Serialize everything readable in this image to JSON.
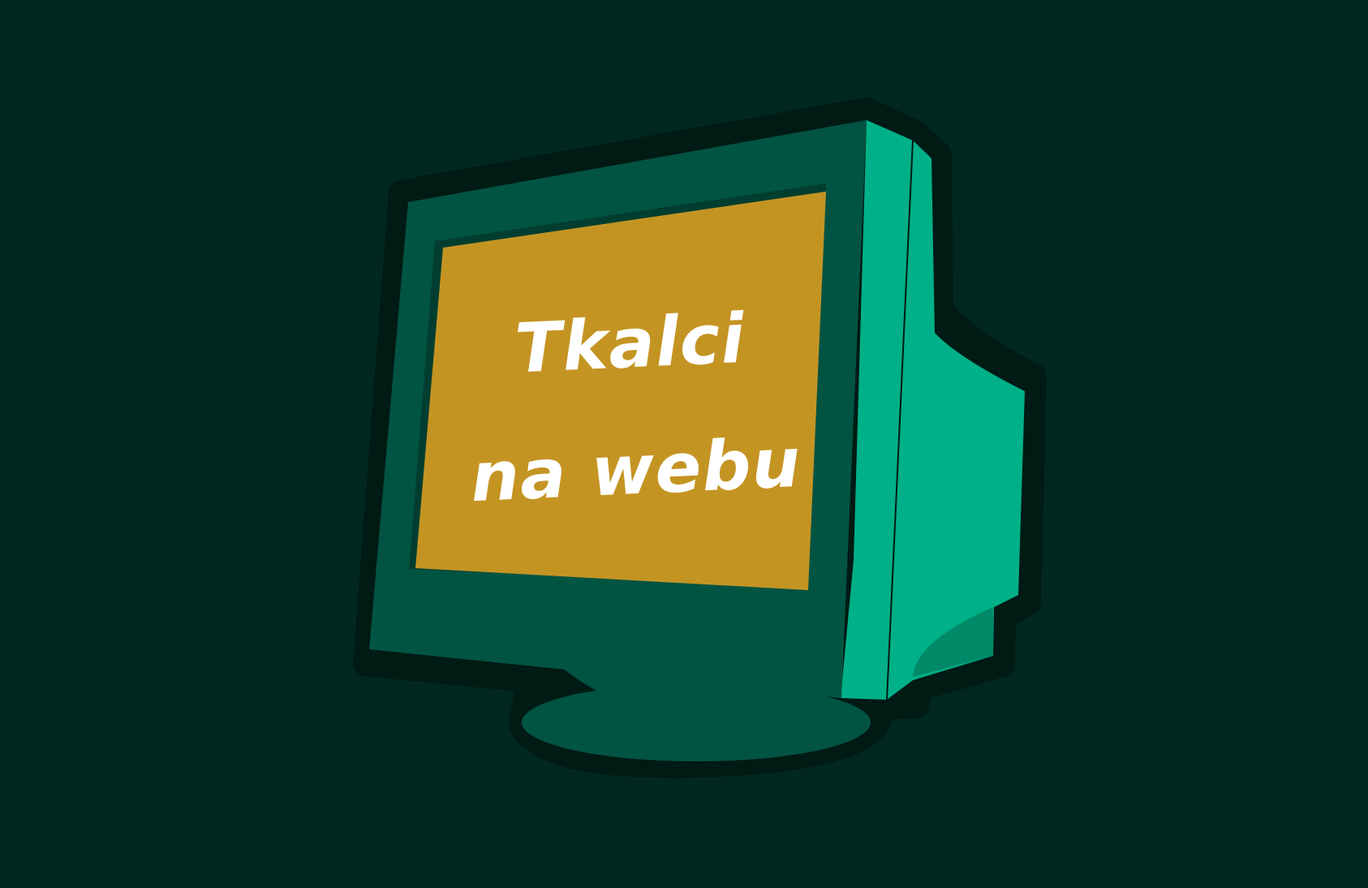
{
  "monitor": {
    "title_line_1": "Tkalci",
    "title_line_2": "na webu"
  },
  "colors": {
    "background": "#002820",
    "outline": "#001a14",
    "bezel": "#025442",
    "casing": "#00b088",
    "casing_shadow": "#008a68",
    "screen": "#c49423",
    "text": "#ffffff"
  }
}
